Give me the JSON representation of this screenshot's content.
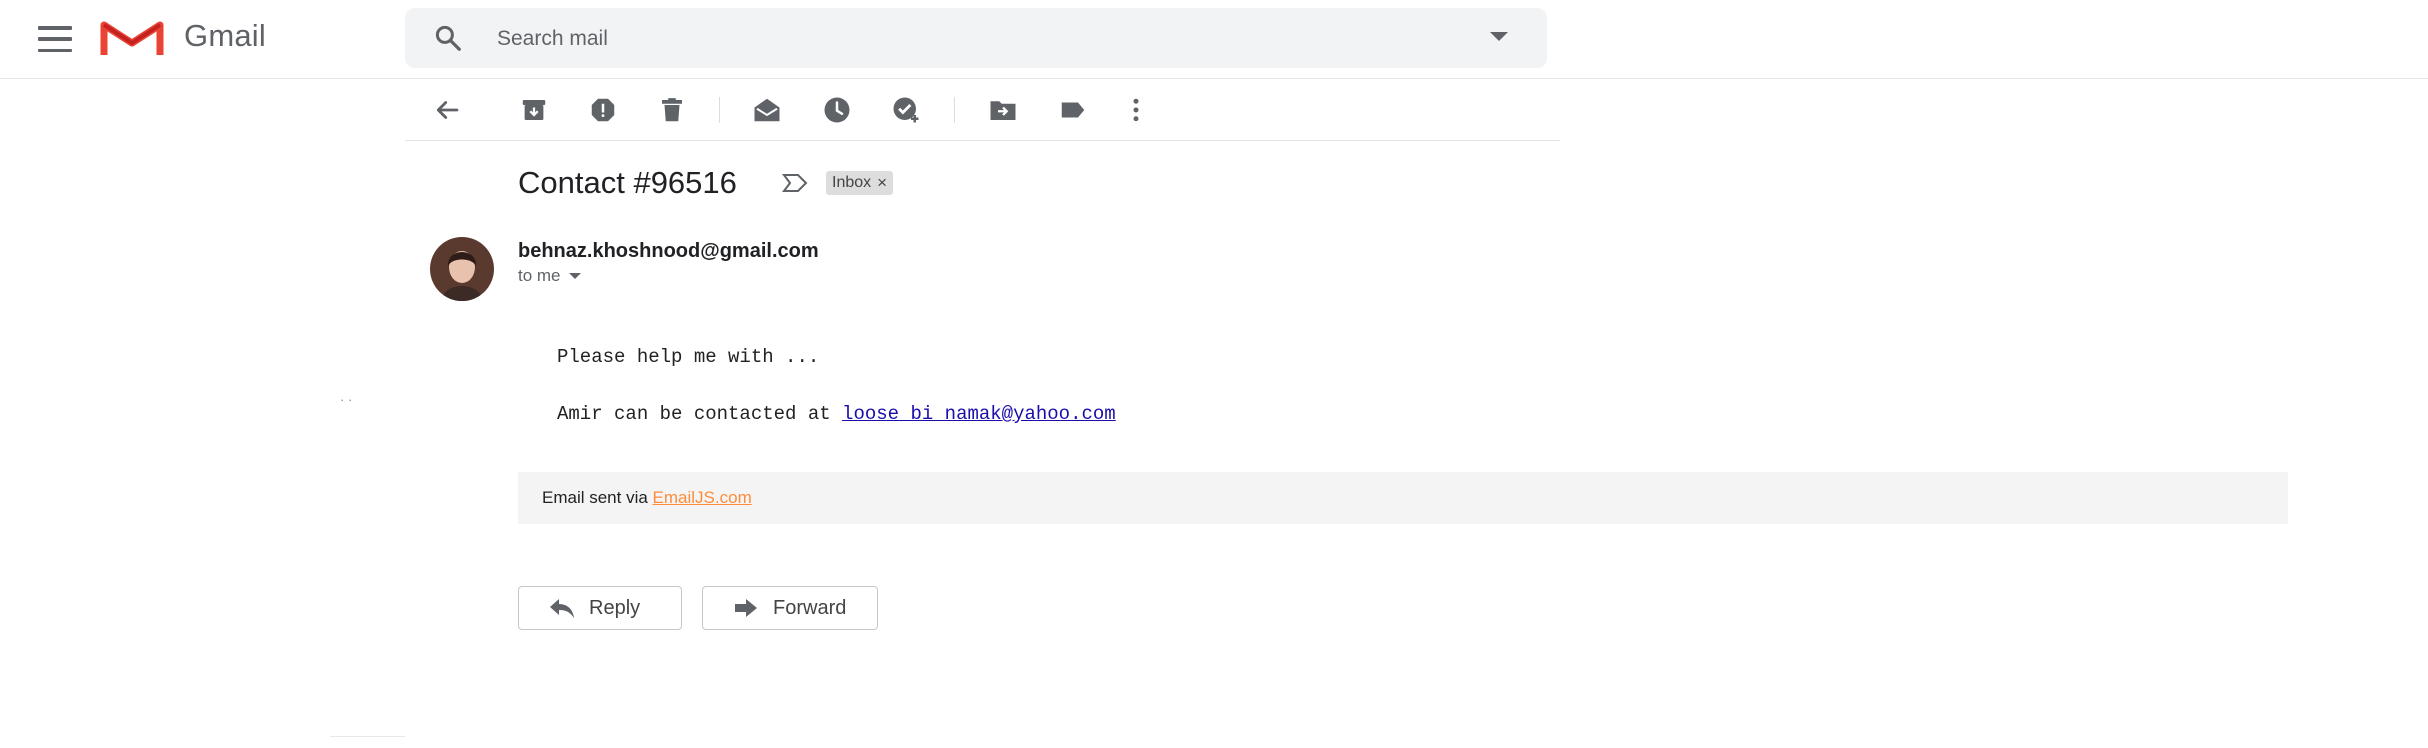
{
  "header": {
    "brand": "Gmail",
    "search_placeholder": "Search mail"
  },
  "toolbar": {
    "icons": [
      "back-arrow-icon",
      "archive-icon",
      "report-spam-icon",
      "delete-icon",
      "mark-unread-icon",
      "snooze-icon",
      "add-to-tasks-icon",
      "move-to-icon",
      "labels-icon",
      "more-icon"
    ]
  },
  "email": {
    "subject": "Contact #96516",
    "label": "Inbox",
    "label_close": "×",
    "sender": "behnaz.khoshnood@gmail.com",
    "recipient": "to me",
    "body_line1": "Please help me with ...",
    "body_line2_prefix": "Amir can be contacted at ",
    "body_email": "loose_bi_namak@yahoo.com",
    "stray_mark": "· ·",
    "footer_prefix": "Email sent via ",
    "footer_link": "EmailJS.com"
  },
  "actions": {
    "reply": "Reply",
    "forward": "Forward"
  },
  "colors": {
    "gmail_red": "#ea4335",
    "link_blue": "#1a0dab",
    "emailjs_orange": "#ff8c3a",
    "icon_gray": "#5f6368"
  }
}
